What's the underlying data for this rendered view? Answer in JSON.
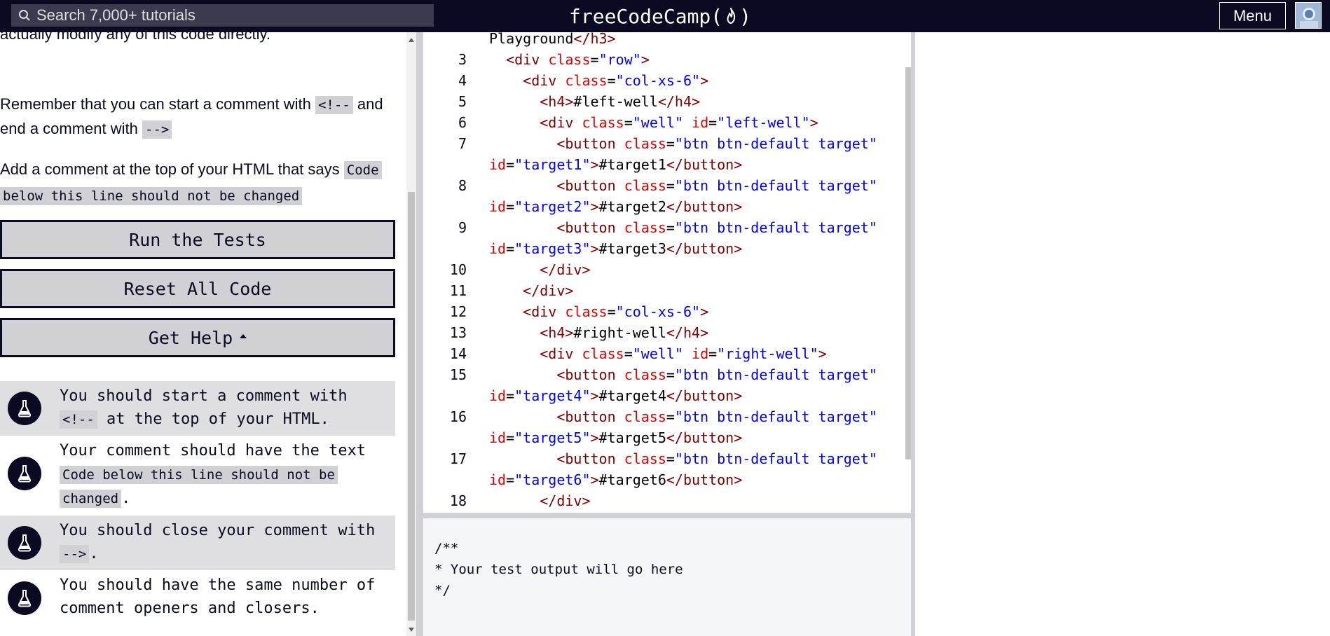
{
  "header": {
    "search_placeholder": "Search 7,000+ tutorials",
    "brand": "freeCodeCamp",
    "brand_open": "(",
    "brand_close": ")",
    "menu_label": "Menu"
  },
  "instructions": {
    "top_fragment": "actually modify any of this code directly.",
    "p1_text_a": "Remember that you can start a comment with",
    "p1_code_a": "<!--",
    "p1_text_b": "and",
    "p1_text_c": "end a comment with",
    "p1_code_b": "-->",
    "p2_text_a": "Add a comment at the top of your HTML that says",
    "p2_code_line1": "Code",
    "p2_code_line2": "below this line should not be changed"
  },
  "actions": {
    "run_tests": "Run the Tests",
    "reset_code": "Reset All Code",
    "get_help": "Get Help"
  },
  "tests": [
    {
      "text_a": "You should start a comment with",
      "code": "<!--",
      "text_b": "at the top of your HTML."
    },
    {
      "text_a": "Your comment should have the text",
      "code_a": "Code below this line should not be",
      "code_b": "changed",
      "text_b": "."
    },
    {
      "text_a": "You should close your comment with",
      "code": "-->",
      "text_b": "."
    },
    {
      "text_a": "You should have the same number of",
      "text_b": "comment openers and closers."
    }
  ],
  "editor": {
    "lines": [
      {
        "n": "",
        "parts": [
          [
            "txt",
            "Playground"
          ],
          [
            "tag",
            "</h3>"
          ]
        ]
      },
      {
        "n": "3",
        "parts": [
          [
            "txt",
            "  "
          ],
          [
            "tag",
            "<div "
          ],
          [
            "attr",
            "class"
          ],
          [
            "txt",
            "="
          ],
          [
            "str",
            "\"row\""
          ],
          [
            "tag",
            ">"
          ]
        ]
      },
      {
        "n": "4",
        "parts": [
          [
            "txt",
            "    "
          ],
          [
            "tag",
            "<div "
          ],
          [
            "attr",
            "class"
          ],
          [
            "txt",
            "="
          ],
          [
            "str",
            "\"col-xs-6\""
          ],
          [
            "tag",
            ">"
          ]
        ]
      },
      {
        "n": "5",
        "parts": [
          [
            "txt",
            "      "
          ],
          [
            "tag",
            "<h4>"
          ],
          [
            "txt",
            "#left-well"
          ],
          [
            "tag",
            "</h4>"
          ]
        ]
      },
      {
        "n": "6",
        "parts": [
          [
            "txt",
            "      "
          ],
          [
            "tag",
            "<div "
          ],
          [
            "attr",
            "class"
          ],
          [
            "txt",
            "="
          ],
          [
            "str",
            "\"well\""
          ],
          [
            "txt",
            " "
          ],
          [
            "attr",
            "id"
          ],
          [
            "txt",
            "="
          ],
          [
            "str",
            "\"left-well\""
          ],
          [
            "tag",
            ">"
          ]
        ]
      },
      {
        "n": "7",
        "parts": [
          [
            "txt",
            "        "
          ],
          [
            "tag",
            "<button "
          ],
          [
            "attr",
            "class"
          ],
          [
            "txt",
            "="
          ],
          [
            "str",
            "\"btn btn-default target\""
          ]
        ]
      },
      {
        "n": "",
        "parts": [
          [
            "attr",
            "id"
          ],
          [
            "txt",
            "="
          ],
          [
            "str",
            "\"target1\""
          ],
          [
            "tag",
            ">"
          ],
          [
            "txt",
            "#target1"
          ],
          [
            "tag",
            "</button>"
          ]
        ]
      },
      {
        "n": "8",
        "parts": [
          [
            "txt",
            "        "
          ],
          [
            "tag",
            "<button "
          ],
          [
            "attr",
            "class"
          ],
          [
            "txt",
            "="
          ],
          [
            "str",
            "\"btn btn-default target\""
          ]
        ]
      },
      {
        "n": "",
        "parts": [
          [
            "attr",
            "id"
          ],
          [
            "txt",
            "="
          ],
          [
            "str",
            "\"target2\""
          ],
          [
            "tag",
            ">"
          ],
          [
            "txt",
            "#target2"
          ],
          [
            "tag",
            "</button>"
          ]
        ]
      },
      {
        "n": "9",
        "parts": [
          [
            "txt",
            "        "
          ],
          [
            "tag",
            "<button "
          ],
          [
            "attr",
            "class"
          ],
          [
            "txt",
            "="
          ],
          [
            "str",
            "\"btn btn-default target\""
          ]
        ]
      },
      {
        "n": "",
        "parts": [
          [
            "attr",
            "id"
          ],
          [
            "txt",
            "="
          ],
          [
            "str",
            "\"target3\""
          ],
          [
            "tag",
            ">"
          ],
          [
            "txt",
            "#target3"
          ],
          [
            "tag",
            "</button>"
          ]
        ]
      },
      {
        "n": "10",
        "parts": [
          [
            "txt",
            "      "
          ],
          [
            "tag",
            "</div>"
          ]
        ]
      },
      {
        "n": "11",
        "parts": [
          [
            "txt",
            "    "
          ],
          [
            "tag",
            "</div>"
          ]
        ]
      },
      {
        "n": "12",
        "parts": [
          [
            "txt",
            "    "
          ],
          [
            "tag",
            "<div "
          ],
          [
            "attr",
            "class"
          ],
          [
            "txt",
            "="
          ],
          [
            "str",
            "\"col-xs-6\""
          ],
          [
            "tag",
            ">"
          ]
        ]
      },
      {
        "n": "13",
        "parts": [
          [
            "txt",
            "      "
          ],
          [
            "tag",
            "<h4>"
          ],
          [
            "txt",
            "#right-well"
          ],
          [
            "tag",
            "</h4>"
          ]
        ]
      },
      {
        "n": "14",
        "parts": [
          [
            "txt",
            "      "
          ],
          [
            "tag",
            "<div "
          ],
          [
            "attr",
            "class"
          ],
          [
            "txt",
            "="
          ],
          [
            "str",
            "\"well\""
          ],
          [
            "txt",
            " "
          ],
          [
            "attr",
            "id"
          ],
          [
            "txt",
            "="
          ],
          [
            "str",
            "\"right-well\""
          ],
          [
            "tag",
            ">"
          ]
        ]
      },
      {
        "n": "15",
        "parts": [
          [
            "txt",
            "        "
          ],
          [
            "tag",
            "<button "
          ],
          [
            "attr",
            "class"
          ],
          [
            "txt",
            "="
          ],
          [
            "str",
            "\"btn btn-default target\""
          ]
        ]
      },
      {
        "n": "",
        "parts": [
          [
            "attr",
            "id"
          ],
          [
            "txt",
            "="
          ],
          [
            "str",
            "\"target4\""
          ],
          [
            "tag",
            ">"
          ],
          [
            "txt",
            "#target4"
          ],
          [
            "tag",
            "</button>"
          ]
        ]
      },
      {
        "n": "16",
        "parts": [
          [
            "txt",
            "        "
          ],
          [
            "tag",
            "<button "
          ],
          [
            "attr",
            "class"
          ],
          [
            "txt",
            "="
          ],
          [
            "str",
            "\"btn btn-default target\""
          ]
        ]
      },
      {
        "n": "",
        "parts": [
          [
            "attr",
            "id"
          ],
          [
            "txt",
            "="
          ],
          [
            "str",
            "\"target5\""
          ],
          [
            "tag",
            ">"
          ],
          [
            "txt",
            "#target5"
          ],
          [
            "tag",
            "</button>"
          ]
        ]
      },
      {
        "n": "17",
        "parts": [
          [
            "txt",
            "        "
          ],
          [
            "tag",
            "<button "
          ],
          [
            "attr",
            "class"
          ],
          [
            "txt",
            "="
          ],
          [
            "str",
            "\"btn btn-default target\""
          ]
        ]
      },
      {
        "n": "",
        "parts": [
          [
            "attr",
            "id"
          ],
          [
            "txt",
            "="
          ],
          [
            "str",
            "\"target6\""
          ],
          [
            "tag",
            ">"
          ],
          [
            "txt",
            "#target6"
          ],
          [
            "tag",
            "</button>"
          ]
        ]
      },
      {
        "n": "18",
        "parts": [
          [
            "txt",
            "      "
          ],
          [
            "tag",
            "</div>"
          ]
        ]
      }
    ]
  },
  "output": {
    "lines": [
      "/**",
      "* Your test output will go here",
      "*/"
    ]
  },
  "colors": {
    "nav_bg": "#0a0a23",
    "search_bg": "#3b3b4f",
    "button_bg": "#d0d0d5",
    "tag": "#800000",
    "attr": "#e50000",
    "string": "#0000ff"
  },
  "icons": {
    "search": "search-icon",
    "flame": "flame-icon",
    "flask": "flask-icon",
    "caret": "caret-up-icon"
  }
}
